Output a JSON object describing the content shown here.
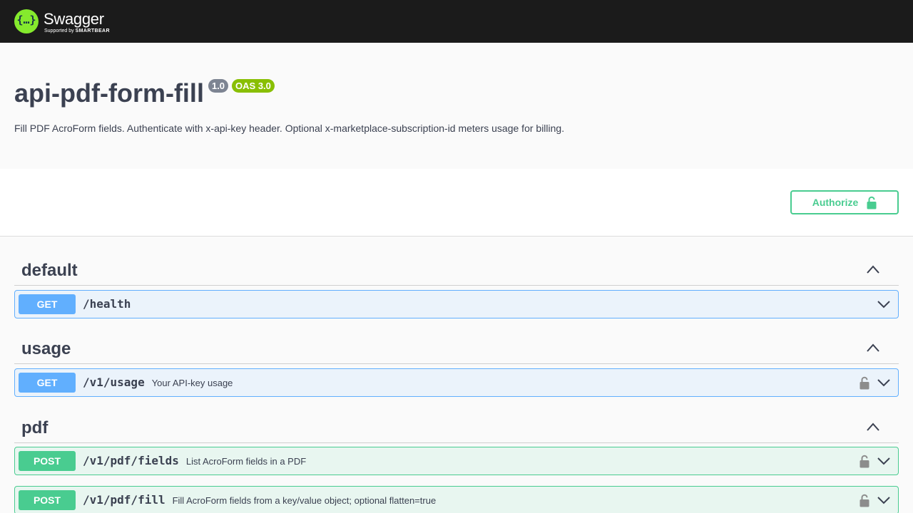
{
  "header": {
    "logo_glyph": "{…}",
    "brand": "Swagger",
    "supported_by": "Supported by",
    "smartbear": "SMARTBEAR",
    "colors": {
      "bg": "#1b1b1b",
      "logo": "#85ea2d"
    }
  },
  "info": {
    "title": "api-pdf-form-fill",
    "version": "1.0",
    "oas": "OAS 3.0",
    "description": "Fill PDF AcroForm fields. Authenticate with x-api-key header. Optional x-marketplace-subscription-id meters usage for billing."
  },
  "auth": {
    "label": "Authorize",
    "icon": "unlock-icon",
    "color": "#49cc90"
  },
  "tags": [
    {
      "name": "default",
      "operations": [
        {
          "method": "GET",
          "path": "/health",
          "summary": "",
          "locked": false
        }
      ]
    },
    {
      "name": "usage",
      "operations": [
        {
          "method": "GET",
          "path": "/v1/usage",
          "summary": "Your API-key usage",
          "locked": true
        }
      ]
    },
    {
      "name": "pdf",
      "operations": [
        {
          "method": "POST",
          "path": "/v1/pdf/fields",
          "summary": "List AcroForm fields in a PDF",
          "locked": true
        },
        {
          "method": "POST",
          "path": "/v1/pdf/fill",
          "summary": "Fill AcroForm fields from a key/value object; optional flatten=true",
          "locked": true
        }
      ]
    }
  ],
  "method_colors": {
    "GET": "#61affe",
    "POST": "#49cc90"
  }
}
